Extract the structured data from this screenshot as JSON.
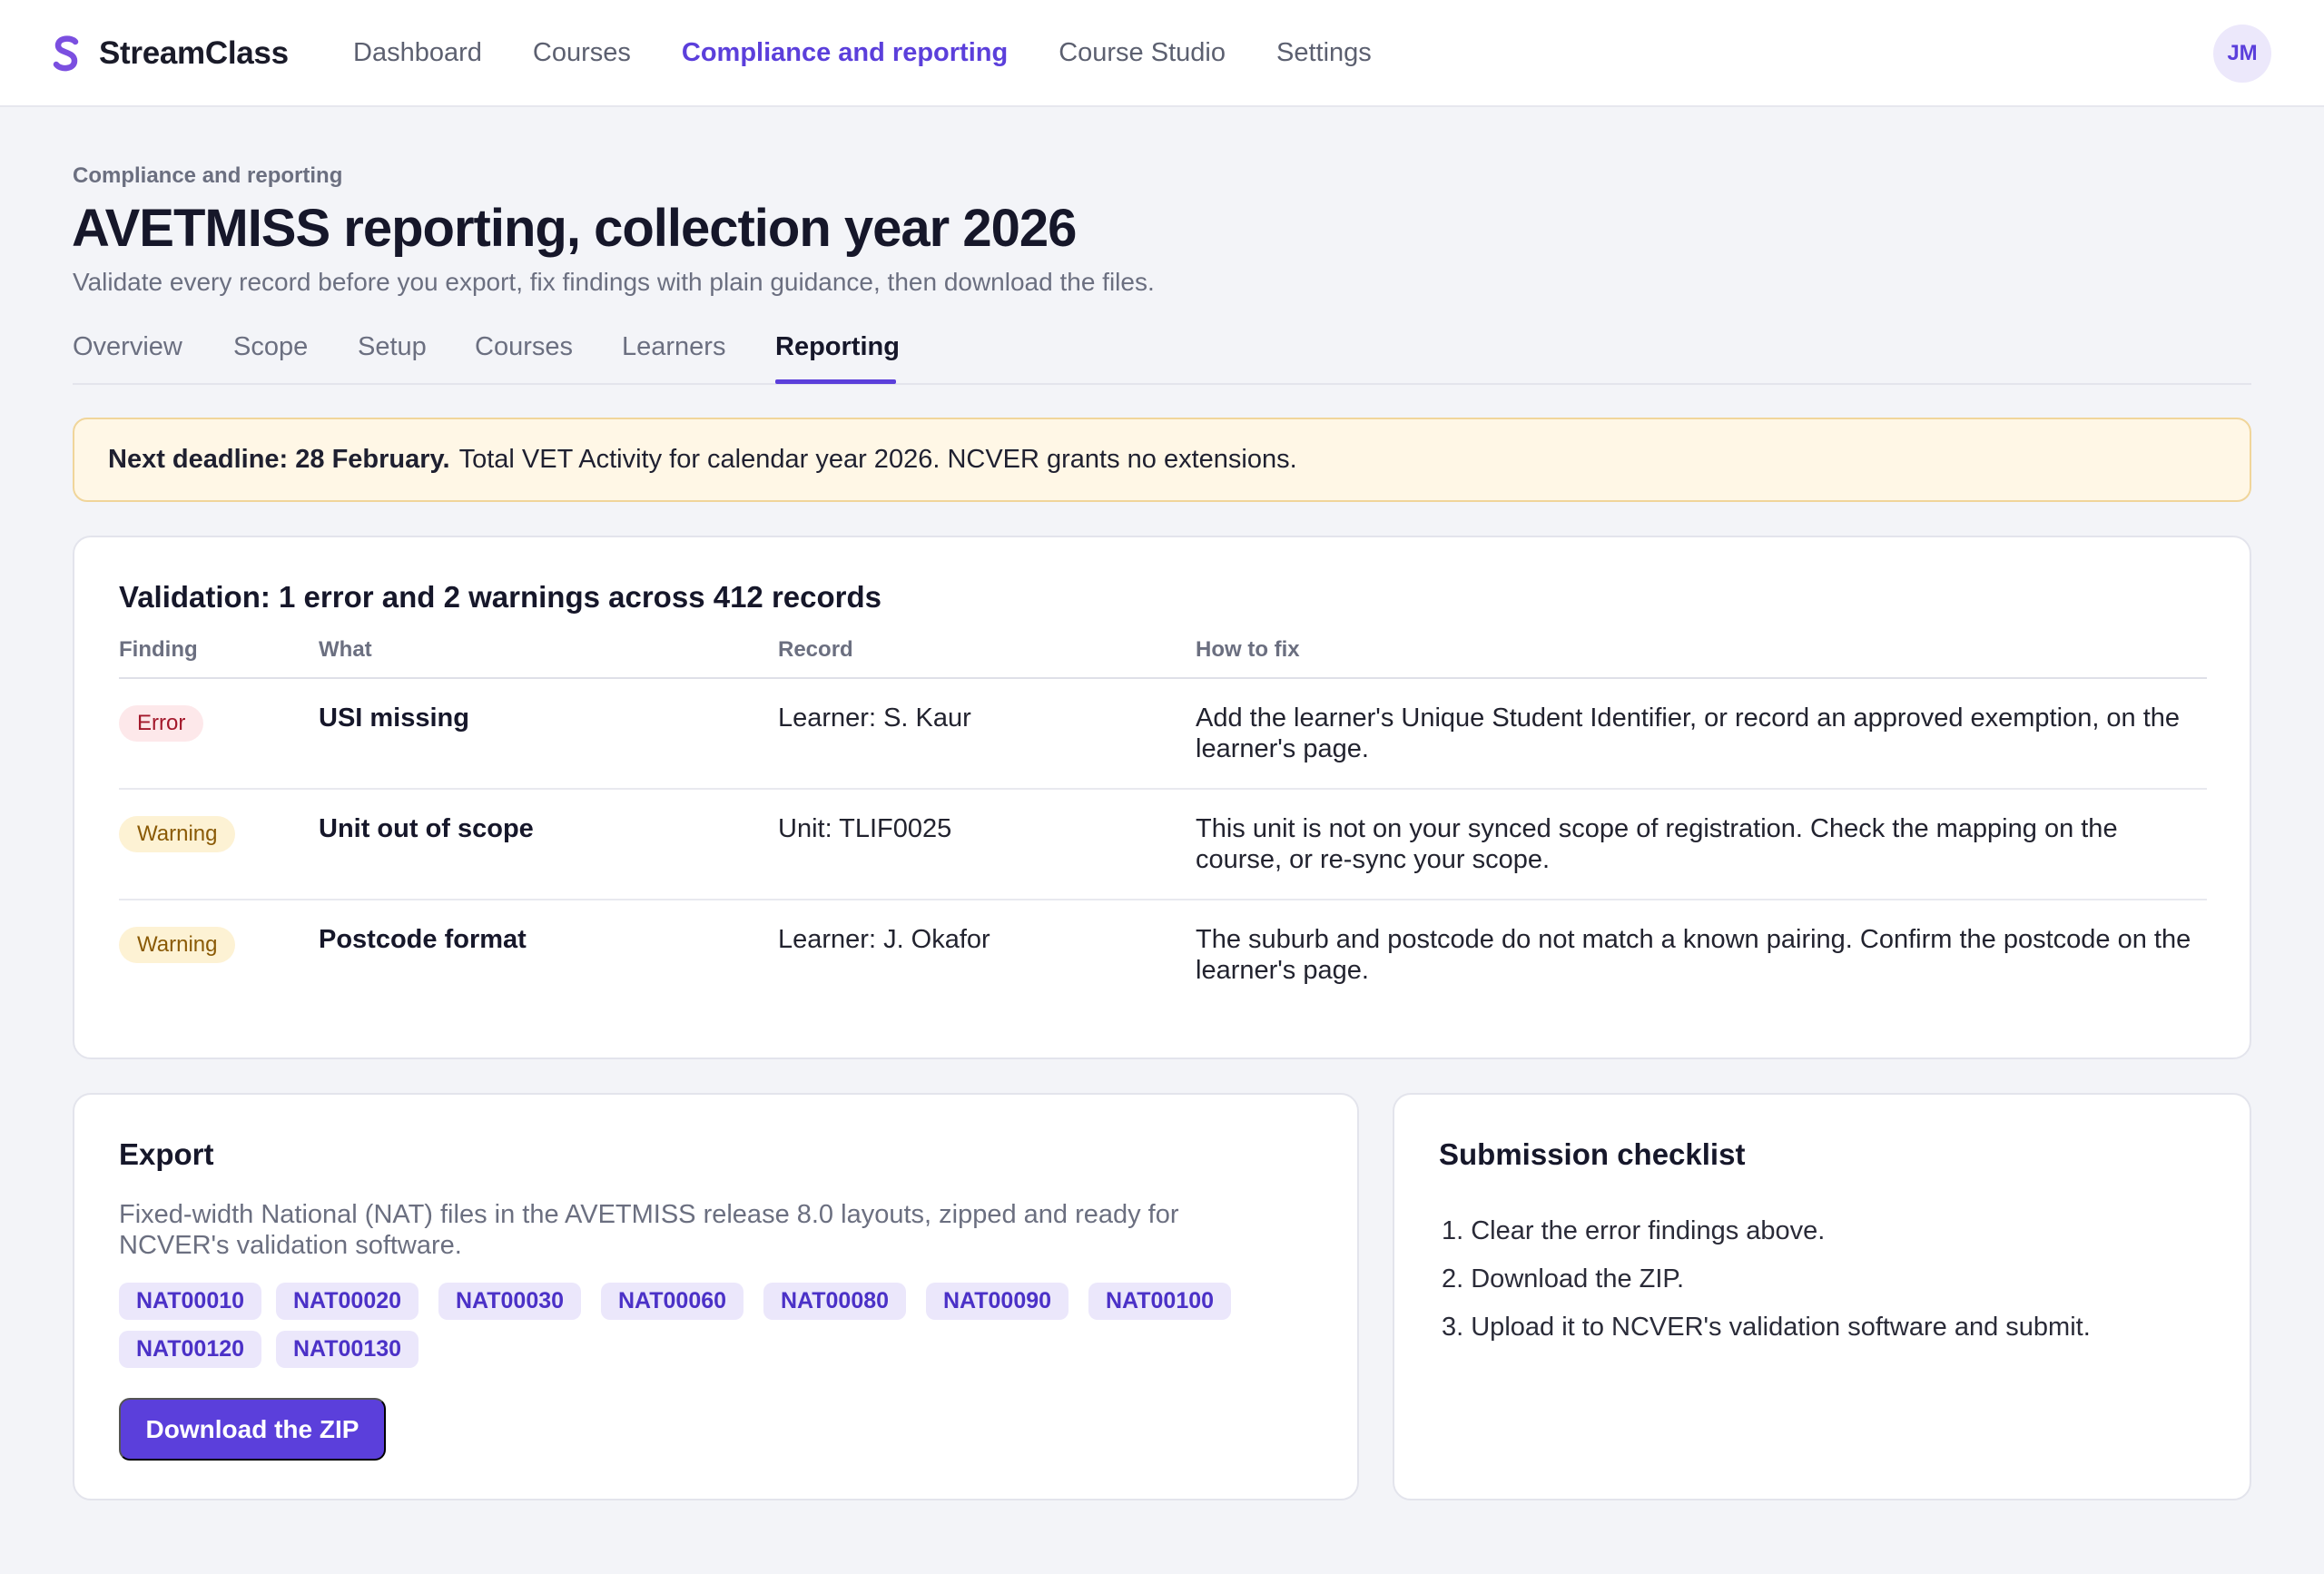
{
  "app": {
    "brand_name": "StreamClass",
    "brand_color": "#7b4fe0",
    "accent_color": "#5b3fdb"
  },
  "nav": {
    "items": [
      {
        "label": "Dashboard",
        "active": false
      },
      {
        "label": "Courses",
        "active": false
      },
      {
        "label": "Compliance and reporting",
        "active": true
      },
      {
        "label": "Course Studio",
        "active": false
      },
      {
        "label": "Settings",
        "active": false
      }
    ],
    "avatar_initials": "JM"
  },
  "page": {
    "breadcrumb": "Compliance and reporting",
    "title": "AVETMISS reporting, collection year 2026",
    "subtitle": "Validate every record before you export, fix findings with plain guidance, then download the files."
  },
  "tabs": [
    {
      "label": "Overview",
      "active": false
    },
    {
      "label": "Scope",
      "active": false
    },
    {
      "label": "Setup",
      "active": false
    },
    {
      "label": "Courses",
      "active": false
    },
    {
      "label": "Learners",
      "active": false
    },
    {
      "label": "Reporting",
      "active": true
    }
  ],
  "deadline": {
    "strong": "Next deadline: 28 February.",
    "text": "Total VET Activity for calendar year 2026. NCVER grants no extensions."
  },
  "validation": {
    "title": "Validation: 1 error and 2 warnings across 412 records",
    "headers": {
      "finding": "Finding",
      "what": "What",
      "record": "Record",
      "fix": "How to fix"
    },
    "rows": [
      {
        "severity": "Error",
        "what": "USI missing",
        "record": "Learner: S. Kaur",
        "fix": "Add the learner's Unique Student Identifier, or record an approved exemption, on the learner's page."
      },
      {
        "severity": "Warning",
        "what": "Unit out of scope",
        "record": "Unit: TLIF0025",
        "fix": "This unit is not on your synced scope of registration. Check the mapping on the course, or re-sync your scope."
      },
      {
        "severity": "Warning",
        "what": "Postcode format",
        "record": "Learner: J. Okafor",
        "fix": "The suburb and postcode do not match a known pairing. Confirm the postcode on the learner's page."
      }
    ]
  },
  "export": {
    "title": "Export",
    "description": "Fixed-width National (NAT) files in the AVETMISS release 8.0 layouts, zipped and ready for NCVER's validation software.",
    "files": [
      "NAT00010",
      "NAT00020",
      "NAT00030",
      "NAT00060",
      "NAT00080",
      "NAT00090",
      "NAT00100",
      "NAT00120",
      "NAT00130"
    ],
    "download_label": "Download the ZIP"
  },
  "checklist": {
    "title": "Submission checklist",
    "items": [
      "1. Clear the error findings above.",
      "2. Download the ZIP.",
      "3. Upload it to NCVER's validation software and submit."
    ]
  }
}
